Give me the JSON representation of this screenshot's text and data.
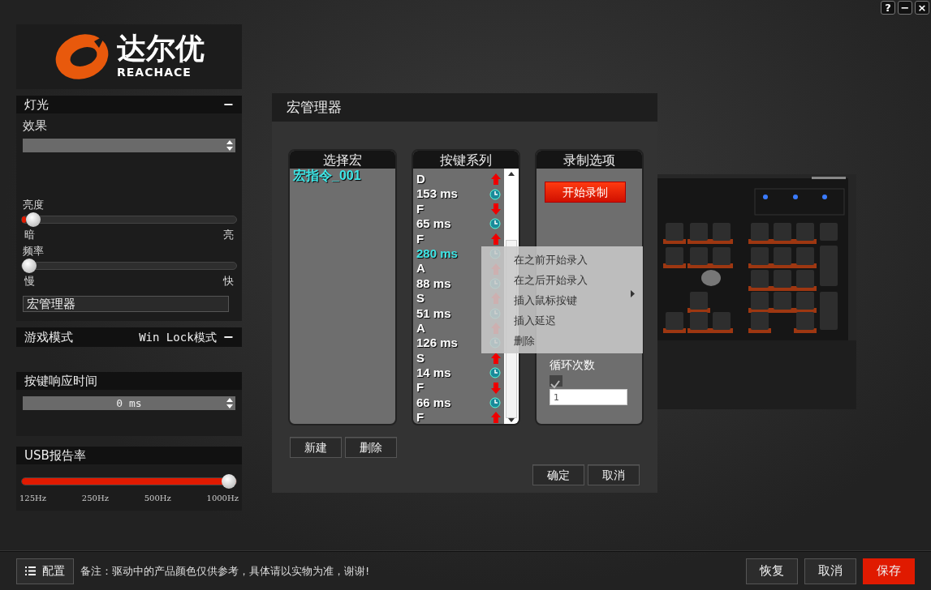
{
  "window_controls": [
    "?",
    "−",
    "×"
  ],
  "logo": {
    "name": "达尔优",
    "subtitle": "REACHACE"
  },
  "lighting": {
    "title": "灯光",
    "collapse": "−",
    "effect_label": "效果",
    "sliders": [
      {
        "label": "亮度",
        "level": 0.02,
        "min_label": "暗",
        "max_label": "亮"
      },
      {
        "label": "频率",
        "level": 0,
        "min_label": "慢",
        "max_label": "快"
      }
    ],
    "macro_manager_button": "宏管理器"
  },
  "game_mode": {
    "title": "游戏模式",
    "option": "Win Lock模式",
    "collapse": "−"
  },
  "key_response": {
    "title": "按键响应时间",
    "value": "0 ms"
  },
  "usb_rate": {
    "title": "USB报告率",
    "level": 1,
    "ticks": [
      "125Hz",
      "250Hz",
      "500Hz",
      "1000Hz"
    ]
  },
  "macro_dialog": {
    "title": "宏管理器",
    "macro_list": {
      "title": "选择宏",
      "items": [
        {
          "label": "宏指令_001",
          "selected": true
        }
      ]
    },
    "sequence": {
      "title": "按键系列",
      "items": [
        {
          "kind": "key",
          "text": "D",
          "key_up": true,
          "selected": false
        },
        {
          "kind": "delay",
          "text": "153 ms",
          "selected": false
        },
        {
          "kind": "key",
          "text": "F",
          "key_up": false,
          "selected": false
        },
        {
          "kind": "delay",
          "text": "65 ms",
          "selected": false
        },
        {
          "kind": "key",
          "text": "F",
          "key_up": true,
          "selected": false
        },
        {
          "kind": "delay",
          "text": "280 ms",
          "selected": true
        },
        {
          "kind": "key",
          "text": "A",
          "key_up": true,
          "selected": false
        },
        {
          "kind": "delay",
          "text": "88 ms",
          "selected": false
        },
        {
          "kind": "key",
          "text": "S",
          "key_up": true,
          "selected": false
        },
        {
          "kind": "delay",
          "text": "51 ms",
          "selected": false
        },
        {
          "kind": "key",
          "text": "A",
          "key_up": true,
          "selected": false
        },
        {
          "kind": "delay",
          "text": "126 ms",
          "selected": false
        },
        {
          "kind": "key",
          "text": "S",
          "key_up": true,
          "selected": false
        },
        {
          "kind": "delay",
          "text": "14 ms",
          "selected": false
        },
        {
          "kind": "key",
          "text": "F",
          "key_up": false,
          "selected": false
        },
        {
          "kind": "delay",
          "text": "66 ms",
          "selected": false
        },
        {
          "kind": "key",
          "text": "F",
          "key_up": true,
          "selected": false
        }
      ]
    },
    "record_options": {
      "title": "录制选项",
      "start_button": "开始录制",
      "loop_label": "循环次数",
      "loop_checked": true,
      "loop_count": "1"
    },
    "list_buttons": [
      "新建",
      "删除"
    ],
    "dialog_buttons": [
      "确定",
      "取消"
    ]
  },
  "context_menu": [
    {
      "label": "在之前开始录入",
      "submenu": false
    },
    {
      "label": "在之后开始录入",
      "submenu": false
    },
    {
      "label": "插入鼠标按键",
      "submenu": true
    },
    {
      "label": "插入延迟",
      "submenu": false
    },
    {
      "label": "删除",
      "submenu": false
    }
  ],
  "keyboard_preview": {
    "kind": "picture"
  },
  "footer": {
    "profile_button": "配置",
    "note": "备注：驱动中的产品颜色仅供参考，具体请以实物为准，谢谢!",
    "buttons": [
      {
        "label": "恢复",
        "primary": false
      },
      {
        "label": "取消",
        "primary": false
      },
      {
        "label": "保存",
        "primary": true
      }
    ]
  }
}
